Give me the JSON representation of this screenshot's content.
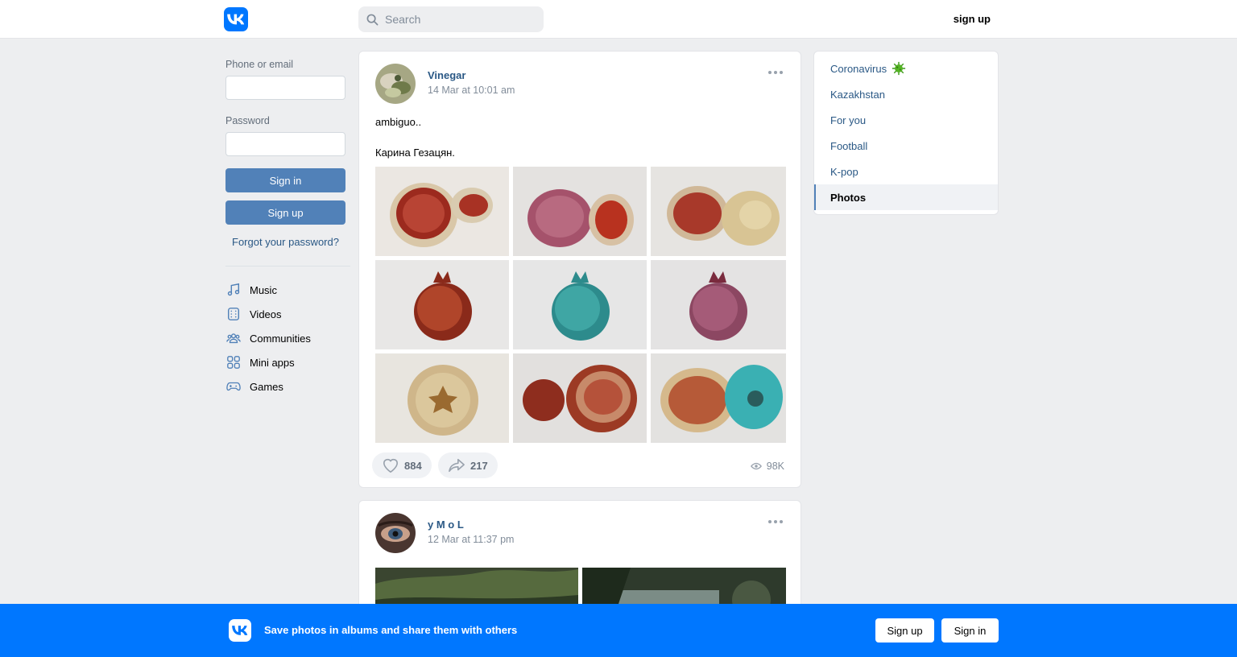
{
  "header": {
    "search_placeholder": "Search",
    "signup_label": "sign up"
  },
  "login": {
    "phone_label": "Phone or email",
    "password_label": "Password",
    "signin_label": "Sign in",
    "signup_label": "Sign up",
    "forgot_label": "Forgot your password?"
  },
  "nav": {
    "items": [
      {
        "label": "Music",
        "icon": "music-icon"
      },
      {
        "label": "Videos",
        "icon": "video-icon"
      },
      {
        "label": "Communities",
        "icon": "communities-icon"
      },
      {
        "label": "Mini apps",
        "icon": "mini-apps-icon"
      },
      {
        "label": "Games",
        "icon": "gamepad-icon"
      }
    ]
  },
  "posts": [
    {
      "author": "Vinegar",
      "date": "14 Mar at 10:01 am",
      "text_lines": [
        "ambiguo..",
        "Карина Гезацян."
      ],
      "likes": "884",
      "shares": "217",
      "views": "98K"
    },
    {
      "author": "y M o L",
      "date": "12 Mar at 11:37 pm"
    }
  ],
  "right_menu": {
    "items": [
      {
        "label": "Coronavirus"
      },
      {
        "label": "Kazakhstan"
      },
      {
        "label": "For you"
      },
      {
        "label": "Football"
      },
      {
        "label": "K-pop"
      },
      {
        "label": "Photos"
      }
    ]
  },
  "banner": {
    "text": "Save photos in albums and share them with others",
    "signup_label": "Sign up",
    "signin_label": "Sign in"
  },
  "colors": {
    "brand": "#0077ff",
    "button": "#5181b8",
    "link": "#2a5885"
  }
}
